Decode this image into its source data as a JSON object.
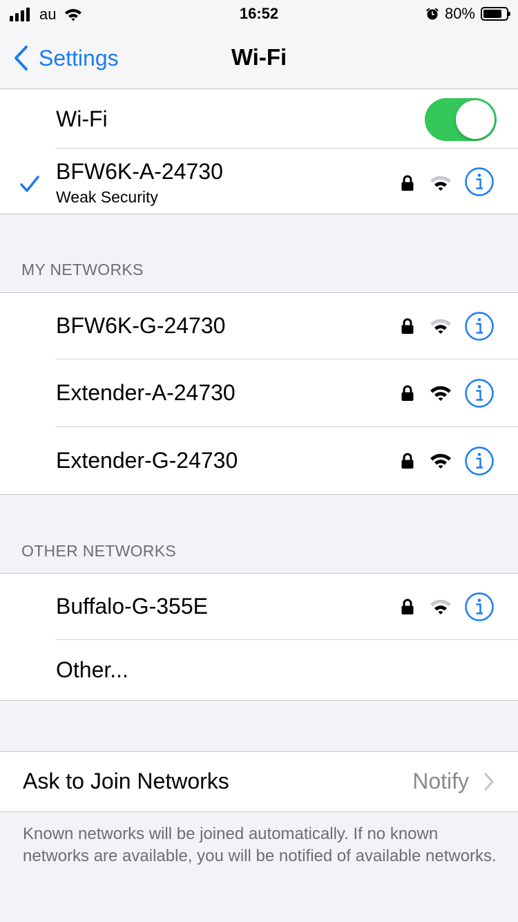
{
  "status_bar": {
    "carrier": "au",
    "time": "16:52",
    "battery_percent": "80%",
    "battery_level": 0.8,
    "signal_bars": 4,
    "icons": [
      "signal-bars-icon",
      "wifi-icon",
      "alarm-icon",
      "battery-icon"
    ]
  },
  "nav": {
    "back_label": "Settings",
    "title": "Wi-Fi"
  },
  "wifi": {
    "label": "Wi-Fi",
    "enabled": true,
    "toggle_color": "#34c759",
    "connected": {
      "name": "BFW6K-A-24730",
      "subtitle": "Weak Security",
      "locked": true,
      "signal": "medium"
    }
  },
  "my_networks": {
    "header": "MY NETWORKS",
    "items": [
      {
        "name": "BFW6K-G-24730",
        "locked": true,
        "signal": "medium"
      },
      {
        "name": "Extender-A-24730",
        "locked": true,
        "signal": "full"
      },
      {
        "name": "Extender-G-24730",
        "locked": true,
        "signal": "full"
      }
    ]
  },
  "other_networks": {
    "header": "OTHER NETWORKS",
    "items": [
      {
        "name": "Buffalo-G-355E",
        "locked": true,
        "signal": "medium"
      }
    ],
    "other_label": "Other..."
  },
  "ask_to_join": {
    "label": "Ask to Join Networks",
    "value": "Notify"
  },
  "footer_text": "Known networks will be joined automatically. If no known networks are available, you will be notified of available networks.",
  "colors": {
    "accent": "#1b7cf3",
    "background": "#f2f2f7",
    "secondary_text": "#6d6d72"
  }
}
